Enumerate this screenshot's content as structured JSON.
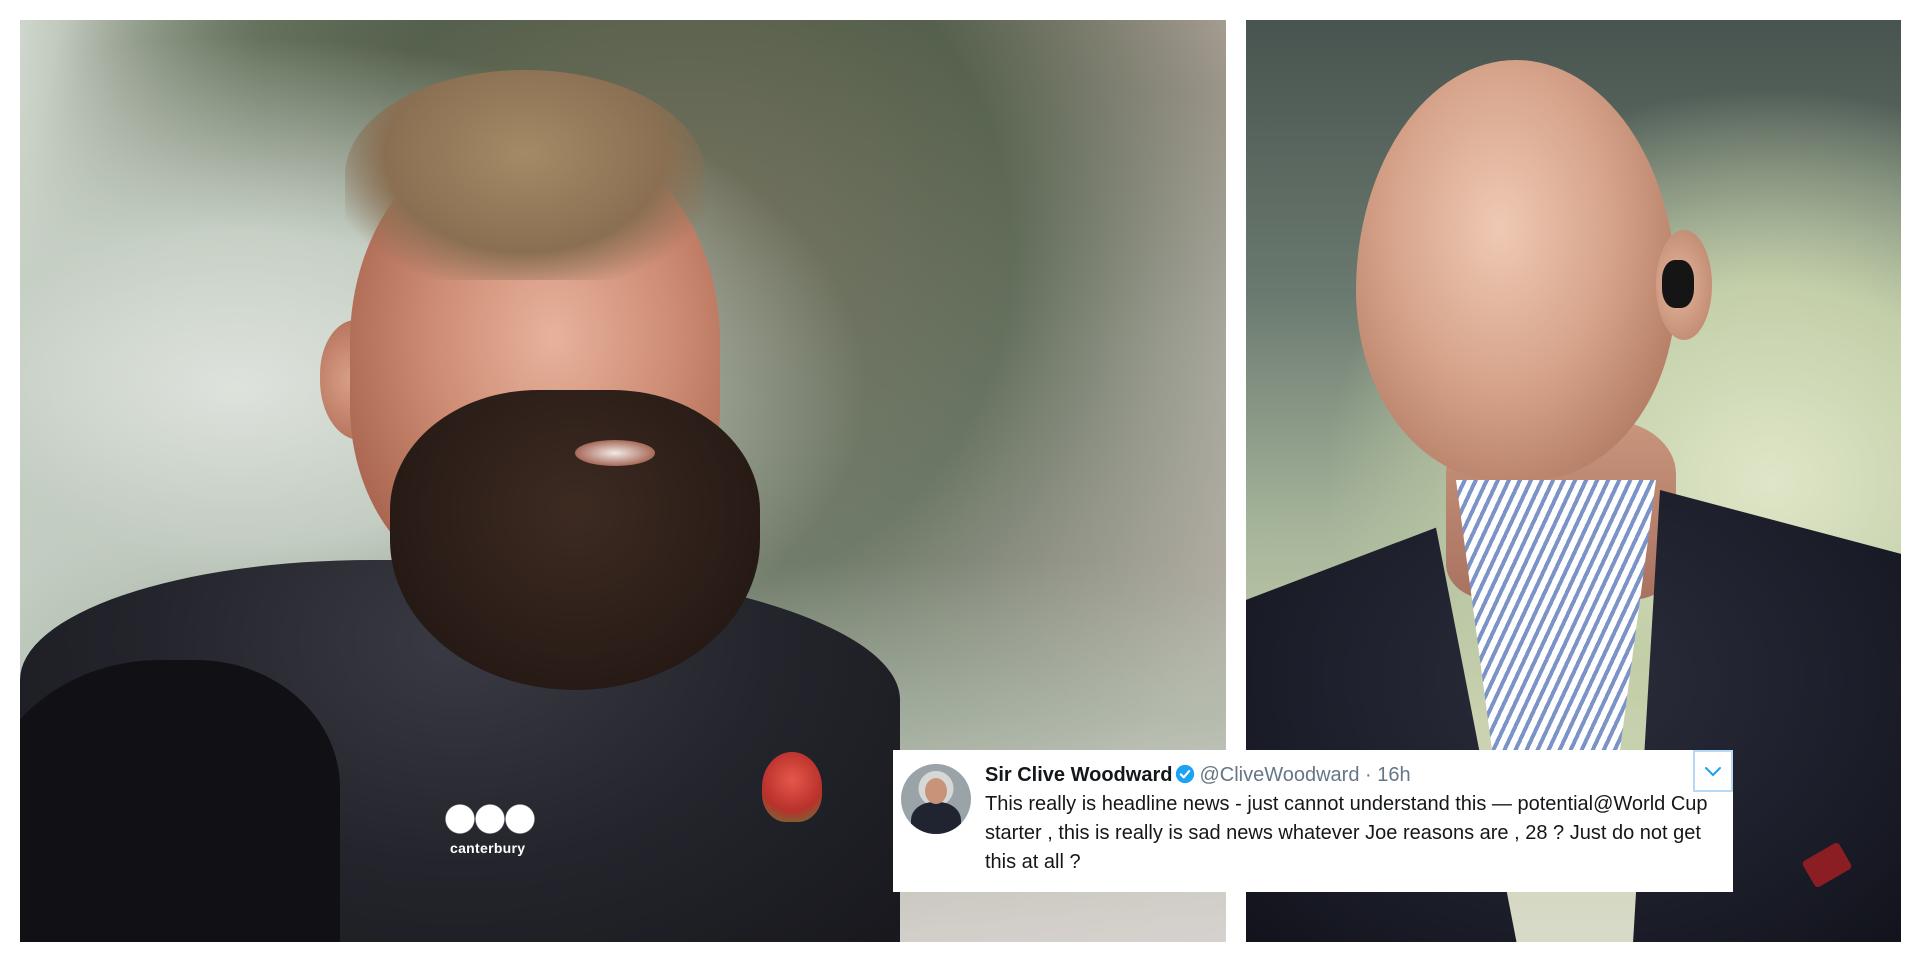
{
  "photos": {
    "left_subject": {
      "kit_logo_text": "canterbury"
    }
  },
  "tweet": {
    "author_name": "Sir Clive Woodward",
    "handle": "@CliveWoodward",
    "separator": "·",
    "time": "16h",
    "text": "This really is headline news - just cannot understand this — potential@World Cup starter , this is really is sad news whatever Joe reasons are , 28 ? Just do not get this at all ?",
    "verified_color": "#1da1f2",
    "icons": {
      "verified": "verified-badge-icon",
      "menu": "chevron-down-icon"
    }
  }
}
